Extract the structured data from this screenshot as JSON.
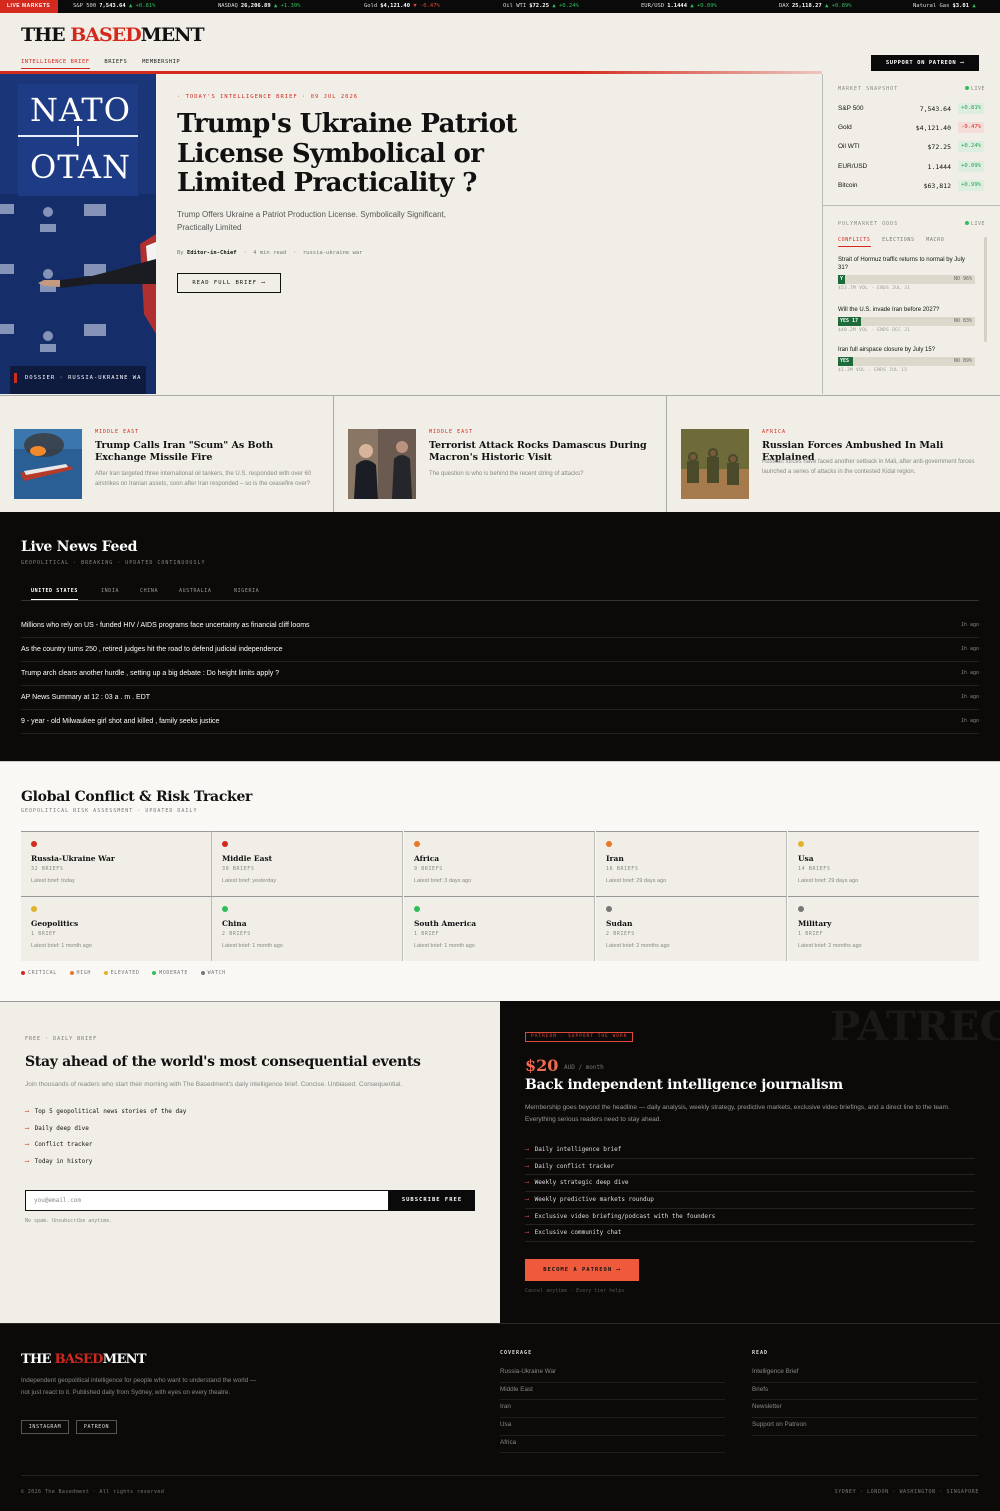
{
  "ticker": {
    "label": "LIVE MARKETS",
    "items": [
      {
        "name": "S&P 500",
        "value": "7,543.64",
        "dir": "▲",
        "change": "+0.81%",
        "up": true
      },
      {
        "name": "NASDAQ",
        "value": "26,206.89",
        "dir": "▲",
        "change": "+1.30%",
        "up": true
      },
      {
        "name": "Gold",
        "value": "$4,121.40",
        "dir": "▼",
        "change": "-0.47%",
        "up": false
      },
      {
        "name": "Oil WTI",
        "value": "$72.25",
        "dir": "▲",
        "change": "+0.24%",
        "up": true
      },
      {
        "name": "EUR/USD",
        "value": "1.1444",
        "dir": "▲",
        "change": "+0.09%",
        "up": true
      },
      {
        "name": "DAX",
        "value": "25,118.27",
        "dir": "▲",
        "change": "+0.89%",
        "up": true
      },
      {
        "name": "Natural Gas",
        "value": "$3.01",
        "dir": "▲",
        "change": "",
        "up": true
      }
    ]
  },
  "header": {
    "logo_a": "THE ",
    "logo_b": "BASED",
    "logo_c": "MENT",
    "nav": [
      "INTELLIGENCE BRIEF",
      "BRIEFS",
      "MEMBERSHIP"
    ],
    "support_label": "SUPPORT ON PATREON ⟶"
  },
  "hero": {
    "image_text_top": "NATO",
    "image_text_bottom": "OTAN",
    "image_caption": "DOSSIER · RUSSIA-UKRAINE WA",
    "kicker": "· TODAY'S INTELLIGENCE BRIEF · 09 JUL 2026",
    "title": "Trump's Ukraine Patriot License Symbolical or Limited Practicality ?",
    "subtitle": "Trump Offers Ukraine a Patriot Production License. Symbolically Significant, Practically Limited",
    "meta_by": "By",
    "meta_author": "Editor-in-Chief",
    "meta_read": "4 min read",
    "meta_tag": "russia-ukraine war",
    "read_label": "READ FULL BRIEF ⟶"
  },
  "market": {
    "label": "MARKET SNAPSHOT",
    "live": "LIVE",
    "rows": [
      {
        "name": "S&P 500",
        "value": "7,543.64",
        "change": "+0.81%",
        "up": true
      },
      {
        "name": "Gold",
        "value": "$4,121.40",
        "change": "-0.47%",
        "up": false
      },
      {
        "name": "Oil WTI",
        "value": "$72.25",
        "change": "+0.24%",
        "up": true
      },
      {
        "name": "EUR/USD",
        "value": "1.1444",
        "change": "+0.09%",
        "up": true
      },
      {
        "name": "Bitcoin",
        "value": "$63,812",
        "change": "+0.99%",
        "up": true
      }
    ]
  },
  "polymarket": {
    "label": "POLYMARKET ODDS",
    "live": "LIVE",
    "tabs": [
      "CONFLICTS",
      "ELECTIONS",
      "MACRO"
    ],
    "items": [
      {
        "q": "Strait of Hormuz traffic returns to normal by July 31?",
        "yes_label": "Y",
        "yes_pct": 4,
        "no_label": "NO 96%",
        "vol": "$53.7M VOL · ENDS JUL 31"
      },
      {
        "q": "Will the U.S. invade Iran before 2027?",
        "yes_label": "YES 17",
        "yes_pct": 17,
        "no_label": "NO 83%",
        "vol": "$40.2M VOL · ENDS DEC 31"
      },
      {
        "q": "Iran full airspace closure by July 15?",
        "yes_label": "YES",
        "yes_pct": 11,
        "no_label": "NO 89%",
        "vol": "$1.3M VOL · ENDS JUL 15"
      }
    ]
  },
  "stories": [
    {
      "cat": "MIDDLE EAST",
      "title": "Trump Calls Iran \"Scum\" As Both Exchange Missile Fire",
      "desc": "After Iran targeted three international oil tankers, the U.S. responded with over 60 airstrikes on Iranian assets, soon after Iran responded – so is the ceasefire over?"
    },
    {
      "cat": "MIDDLE EAST",
      "title": "Terrorist Attack Rocks Damascus During Macron's Historic Visit",
      "desc": "The question is who is behind the recent string of attacks?"
    },
    {
      "cat": "AFRICA",
      "title": "Russian Forces Ambushed In Mali Explained",
      "desc": "Russian forces have faced another setback in Mali, after anti-government forces launched a series of attacks in the contested Kidal region."
    }
  ],
  "feed": {
    "title": "Live News Feed",
    "subtitle": "GEOPOLITICAL · BREAKING · UPDATED CONTINUOUSLY",
    "tabs": [
      "UNITED STATES",
      "INDIA",
      "CHINA",
      "AUSTRALIA",
      "NIGERIA"
    ],
    "items": [
      {
        "headline": "Millions who rely on US - funded HIV / AIDS programs face uncertainty as financial cliff looms",
        "age": "1h ago"
      },
      {
        "headline": "As the country turns 250 , retired judges hit the road to defend judicial independence",
        "age": "1h ago"
      },
      {
        "headline": "Trump arch clears another hurdle , setting up a big debate : Do height limits apply ?",
        "age": "1h ago"
      },
      {
        "headline": "AP News Summary at 12 : 03 a . m . EDT",
        "age": "1h ago"
      },
      {
        "headline": "9 - year - old Milwaukee girl shot and killed , family seeks justice",
        "age": "1h ago"
      }
    ]
  },
  "tracker": {
    "title": "Global Conflict & Risk Tracker",
    "subtitle": "GEOPOLITICAL RISK ASSESSMENT · UPDATED DAILY",
    "regions": [
      {
        "name": "Russia-Ukraine War",
        "count": "32 BRIEFS",
        "latest": "Latest brief: today",
        "color": "#d42a1e"
      },
      {
        "name": "Middle East",
        "count": "30 BRIEFS",
        "latest": "Latest brief: yesterday",
        "color": "#d42a1e"
      },
      {
        "name": "Africa",
        "count": "9 BRIEFS",
        "latest": "Latest brief: 3 days ago",
        "color": "#e8782a"
      },
      {
        "name": "Iran",
        "count": "16 BRIEFS",
        "latest": "Latest brief: 29 days ago",
        "color": "#e8782a"
      },
      {
        "name": "Usa",
        "count": "14 BRIEFS",
        "latest": "Latest brief: 29 days ago",
        "color": "#e2b22a"
      },
      {
        "name": "Geopolitics",
        "count": "1 BRIEF",
        "latest": "Latest brief: 1 month ago",
        "color": "#e2b22a"
      },
      {
        "name": "China",
        "count": "2 BRIEFS",
        "latest": "Latest brief: 1 month ago",
        "color": "#2fbf5a"
      },
      {
        "name": "South America",
        "count": "1 BRIEF",
        "latest": "Latest brief: 1 month ago",
        "color": "#2fbf5a"
      },
      {
        "name": "Sudan",
        "count": "2 BRIEFS",
        "latest": "Latest brief: 2 months ago",
        "color": "#777777"
      },
      {
        "name": "Military",
        "count": "1 BRIEF",
        "latest": "Latest brief: 2 months ago",
        "color": "#777777"
      }
    ],
    "legend": [
      {
        "label": "CRITICAL",
        "color": "#d42a1e"
      },
      {
        "label": "HIGH",
        "color": "#e8782a"
      },
      {
        "label": "ELEVATED",
        "color": "#e2b22a"
      },
      {
        "label": "MODERATE",
        "color": "#2fbf5a"
      },
      {
        "label": "WATCH",
        "color": "#777777"
      }
    ]
  },
  "newsletter": {
    "kicker": "FREE · DAILY BRIEF",
    "title": "Stay ahead of the world's most consequential events",
    "subtitle": "Join thousands of readers who start their morning with The Basedment's daily intelligence brief. Concise. Unbiased. Consequential.",
    "items": [
      "Top 5 geopolitical news stories of the day",
      "Daily deep dive",
      "Conflict tracker",
      "Today in history"
    ],
    "placeholder": "you@email.com",
    "button": "SUBSCRIBE FREE",
    "note": "No spam. Unsubscribe anytime."
  },
  "patreon": {
    "ghost": "PATREON",
    "badge": "PATREON · SUPPORT THE WORK",
    "price": "$20",
    "unit": "AUD / month",
    "title": "Back independent intelligence journalism",
    "subtitle": "Membership goes beyond the headline — daily analysis, weekly strategy, predictive markets, exclusive video briefings, and a direct line to the team. Everything serious readers need to stay ahead.",
    "items": [
      "Daily intelligence brief",
      "Daily conflict tracker",
      "Weekly strategic deep dive",
      "Weekly predictive markets roundup",
      "Exclusive video briefing/podcast with the founders",
      "Exclusive community chat"
    ],
    "button": "BECOME A PATREON ⟶",
    "note": "Cancel anytime · Every tier helps"
  },
  "footer": {
    "desc": "Independent geopolitical intelligence for people who want to understand the world — not just react to it. Published daily from Sydney, with eyes on every theatre.",
    "buttons": [
      "INSTAGRAM",
      "PATREON"
    ],
    "coverage_title": "COVERAGE",
    "coverage": [
      "Russia-Ukraine War",
      "Middle East",
      "Iran",
      "Usa",
      "Africa"
    ],
    "read_title": "READ",
    "read": [
      "Intelligence Brief",
      "Briefs",
      "Newsletter",
      "Support on Patreon"
    ],
    "copyright": "© 2026 The Basedment · All rights reserved",
    "cities": "SYDNEY · LONDON · WASHINGTON · SINGAPORE"
  }
}
